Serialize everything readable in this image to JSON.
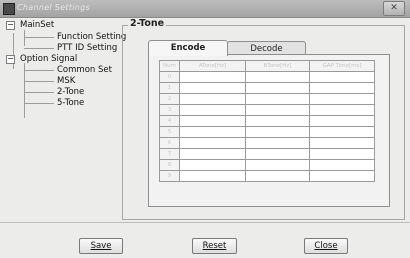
{
  "window": {
    "title": "Channel Settings"
  },
  "tree": {
    "mainset": "MainSet",
    "function_setting": "Function Setting",
    "ptt_id_setting": "PTT ID Setting",
    "option_signal": "Option Signal",
    "common_set": "Common Set",
    "msk": "MSK",
    "two_tone": "2-Tone",
    "five_tone": "5-Tone"
  },
  "panel": {
    "title": "2-Tone",
    "tabs": [
      "Encode",
      "Decode"
    ],
    "active_tab": "Encode",
    "columns": [
      "Num",
      "ATone[Hz]",
      "BTone[Hz]",
      "GAP Time[ms]"
    ],
    "rows": [
      {
        "num": "0",
        "a": "",
        "b": "",
        "gap": ""
      },
      {
        "num": "1",
        "a": "",
        "b": "",
        "gap": ""
      },
      {
        "num": "2",
        "a": "",
        "b": "",
        "gap": ""
      },
      {
        "num": "3",
        "a": "",
        "b": "",
        "gap": ""
      },
      {
        "num": "4",
        "a": "",
        "b": "",
        "gap": ""
      },
      {
        "num": "5",
        "a": "",
        "b": "",
        "gap": ""
      },
      {
        "num": "6",
        "a": "",
        "b": "",
        "gap": ""
      },
      {
        "num": "7",
        "a": "",
        "b": "",
        "gap": ""
      },
      {
        "num": "8",
        "a": "",
        "b": "",
        "gap": ""
      },
      {
        "num": "9",
        "a": "",
        "b": "",
        "gap": ""
      }
    ]
  },
  "buttons": {
    "save": "Save",
    "reset": "Reset",
    "close": "Close"
  },
  "icons": {
    "app": "app-icon",
    "close": "close-icon"
  }
}
